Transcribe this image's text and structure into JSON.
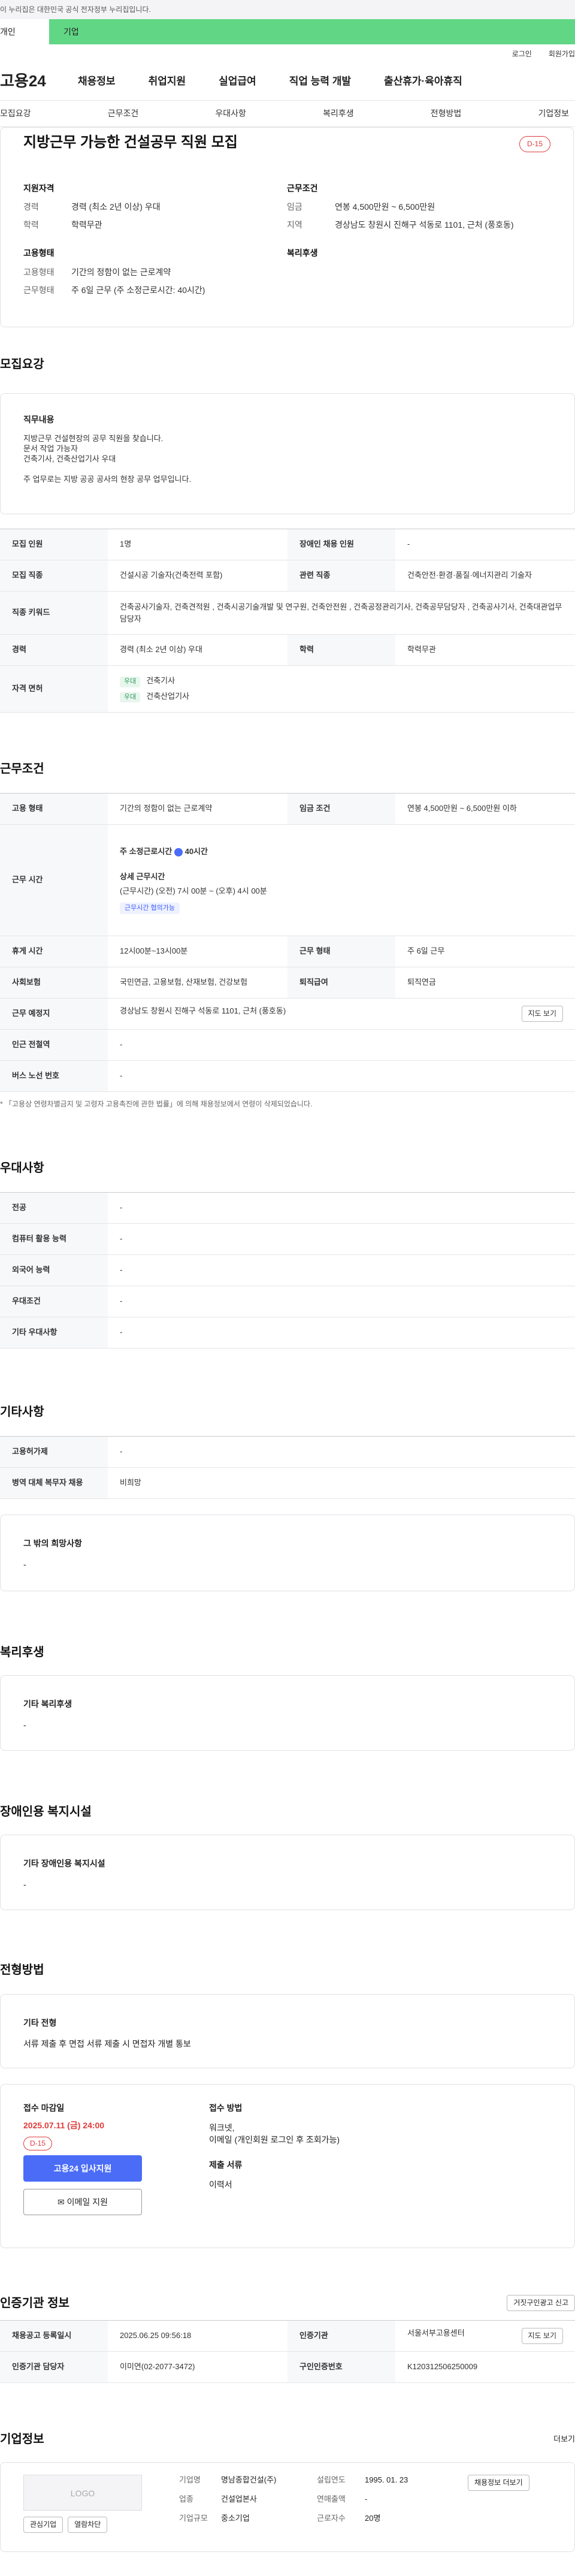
{
  "topbar": {
    "notice": "이 누리집은 대한민국 공식 전자정부 누리집입니다.",
    "role_personal": "개인",
    "role_company": "기업"
  },
  "utility": {
    "login": "로그인",
    "signup": "회원가입"
  },
  "gnb": {
    "logo": "고용24",
    "items": [
      "채용정보",
      "취업지원",
      "실업급여",
      "직업 능력 개발",
      "출산휴가·육아휴직"
    ]
  },
  "tabs": [
    "모집요강",
    "근무조건",
    "우대사항",
    "복리후생",
    "전형방법",
    "기업정보"
  ],
  "header": {
    "title": "지방근무 가능한 건설공무 직원 모집",
    "dday": "D-15",
    "qual_h": "지원자격",
    "career_k": "경력",
    "career_v": "경력 (최소 2년 이상) 우대",
    "edu_k": "학력",
    "edu_v": "학력무관",
    "emp_h": "고용형태",
    "emp_k": "고용형태",
    "emp_v": "기간의 정함이 없는 근로계약",
    "worktype_k": "근무형태",
    "worktype_v": "주 6일 근무 (주 소정근로시간: 40시간)",
    "cond_h": "근무조건",
    "wage_k": "임금",
    "wage_v": "연봉 4,500만원 ~ 6,500만원",
    "area_k": "지역",
    "area_v": "경상남도 창원시 진해구 석동로 1101, 근처 (풍호동)",
    "welfare_h": "복리후생"
  },
  "recruit": {
    "title": "모집요강",
    "duty_h": "직무내용",
    "duty_lines": [
      "지방근무 건설현장의 공무 직원을 찾습니다.",
      "문서 작업 가능자",
      "건축기사, 건축산업기사 우대",
      "",
      "주 업무로는 지방 공공 공사의 현장 공무 업무입니다."
    ],
    "rows": {
      "count_k": "모집 인원",
      "count_v": "1명",
      "disabled_k": "장애인 채용 인원",
      "disabled_v": "-",
      "job_k": "모집 직종",
      "job_v": "건설시공 기술자(건축전력 포함)",
      "related_k": "관련 직종",
      "related_v": "건축안전·환경·품질·에너지관리 기술자",
      "kw_k": "직종 키워드",
      "kw_v": "건축공사기술자, 건축견적원 , 건축시공기술개발 및 연구원, 건축안전원 , 건축공정관리기사, 건축공무담당자 , 건축공사기사, 건축대관업무담당자",
      "exp_k": "경력",
      "exp_v": "경력 (최소 2년 이상) 우대",
      "edu_k": "학력",
      "edu_v": "학력무관",
      "lic_k": "자격 면허",
      "lic_badge": "우대",
      "lic1": "건축기사",
      "lic2": "건축산업기사"
    }
  },
  "work": {
    "title": "근무조건",
    "emp_k": "고용 형태",
    "emp_v": "기간의 정함이 없는 근로계약",
    "wage_k": "임금 조건",
    "wage_v": "연봉 4,500만원 ~ 6,500만원 이하",
    "time_k": "근무 시간",
    "weekly": "주 소정근로시간",
    "weekly_v": "40시간",
    "detail_h": "상세 근무시간",
    "detail_v": "(근무시간) (오전) 7시 00분 ~ (오후) 4시 00분",
    "flex": "근무시간 협의가능",
    "rest_k": "휴게 시간",
    "rest_v": "12시00분~13시00분",
    "form_k": "근무 형태",
    "form_v": "주 6일 근무",
    "ins_k": "사회보험",
    "ins_v": "국민연금, 고용보험, 산재보험, 건강보험",
    "sev_k": "퇴직급여",
    "sev_v": "퇴직연금",
    "place_k": "근무 예정지",
    "place_v": "경상남도 창원시 진해구 석동로 1101, 근처 (풍호동)",
    "map": "지도 보기",
    "sub_k": "인근 전철역",
    "sub_v": "-",
    "bus_k": "버스 노선 번호",
    "bus_v": "-",
    "note": "* 「고용상 연령차별금지 및 고령자 고용촉진에 관한 법률」에 의해 채용정보에서 연령이 삭제되었습니다."
  },
  "pref": {
    "title": "우대사항",
    "rows": [
      [
        "전공",
        "-"
      ],
      [
        "컴퓨터 활용 능력",
        "-"
      ],
      [
        "외국어 능력",
        "-"
      ],
      [
        "우대조건",
        "-"
      ],
      [
        "기타 우대사항",
        "-"
      ]
    ]
  },
  "etc": {
    "title": "기타사항",
    "r1k": "고용허가제",
    "r1v": "-",
    "r2k": "병역 대체 복무자 채용",
    "r2v": "비희망",
    "wish_h": "그 밖의 희망사항",
    "wish_v": "-"
  },
  "welfare": {
    "title": "복리후생",
    "h": "기타 복리후생",
    "v": "-"
  },
  "disab": {
    "title": "장애인용 복지시설",
    "h": "기타 장애인용 복지시설",
    "v": "-"
  },
  "process": {
    "title": "전형방법",
    "h": "기타 전형",
    "v": "서류 제출 후 면접 서류 제출 시 면접자 개별 통보",
    "deadline_h": "접수 마감일",
    "deadline_v": "2025.07.11 (금) 24:00",
    "dday": "D-15",
    "apply": "고용24 입사지원",
    "email": "이메일 지원",
    "method_h": "접수 방법",
    "method_v1": "워크넷,",
    "method_v2": "이메일 (개인회원 로그인 후 조회가능)",
    "docs_h": "제출 서류",
    "docs_v": "이력서"
  },
  "agency": {
    "title": "인증기관 정보",
    "report": "거짓구인광고 신고",
    "reg_k": "채용공고 등록일시",
    "reg_v": "2025.06.25 09:56:18",
    "org_k": "인증기관",
    "org_v": "서울서부고용센터",
    "map": "지도 보기",
    "mgr_k": "인증기관 담당자",
    "mgr_v": "이미연(02-2077-3472)",
    "no_k": "구인인증번호",
    "no_v": "K120312506250009"
  },
  "company": {
    "title": "기업정보",
    "more": "더보기",
    "logo": "LOGO",
    "fav": "관심기업",
    "block": "열람차단",
    "name_k": "기업명",
    "name_v": "명남종합건설(주)",
    "est_k": "설립연도",
    "est_v": "1995. 01. 23",
    "ind_k": "업종",
    "ind_v": "건설업본사",
    "sales_k": "연매출액",
    "sales_v": "-",
    "size_k": "기업규모",
    "size_v": "중소기업",
    "emp_k": "근로자수",
    "emp_v": "20명",
    "info_btn": "채용정보 더보기"
  }
}
